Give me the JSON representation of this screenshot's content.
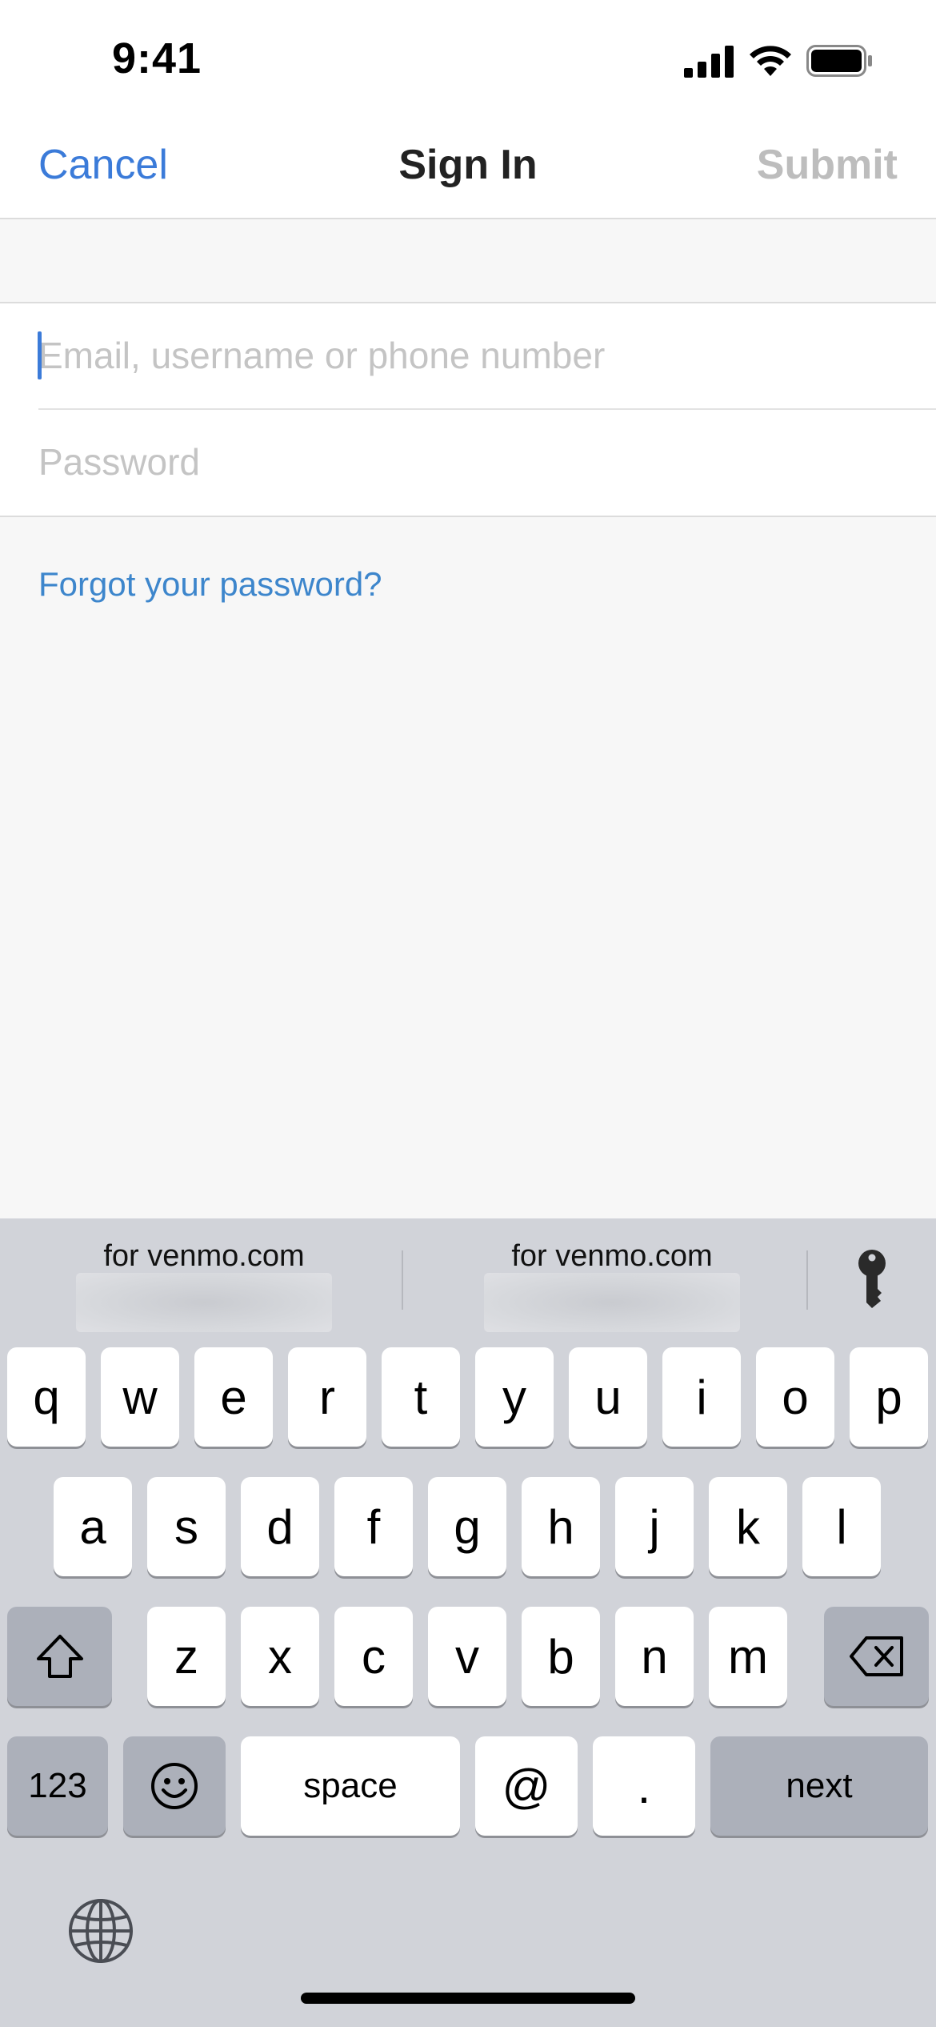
{
  "status_bar": {
    "time": "9:41"
  },
  "nav": {
    "cancel": "Cancel",
    "title": "Sign In",
    "submit": "Submit"
  },
  "form": {
    "email_placeholder": "Email, username or phone number",
    "password_placeholder": "Password",
    "forgot": "Forgot your password?"
  },
  "keyboard": {
    "suggestions": [
      "for venmo.com",
      "for venmo.com"
    ],
    "row1": [
      "q",
      "w",
      "e",
      "r",
      "t",
      "y",
      "u",
      "i",
      "o",
      "p"
    ],
    "row2": [
      "a",
      "s",
      "d",
      "f",
      "g",
      "h",
      "j",
      "k",
      "l"
    ],
    "row3": [
      "z",
      "x",
      "c",
      "v",
      "b",
      "n",
      "m"
    ],
    "numbers": "123",
    "space": "space",
    "at": "@",
    "dot": ".",
    "next": "next"
  },
  "colors": {
    "accent": "#3b7bd9",
    "link": "#3d86cc",
    "submit_disabled": "#bdbdbd"
  }
}
